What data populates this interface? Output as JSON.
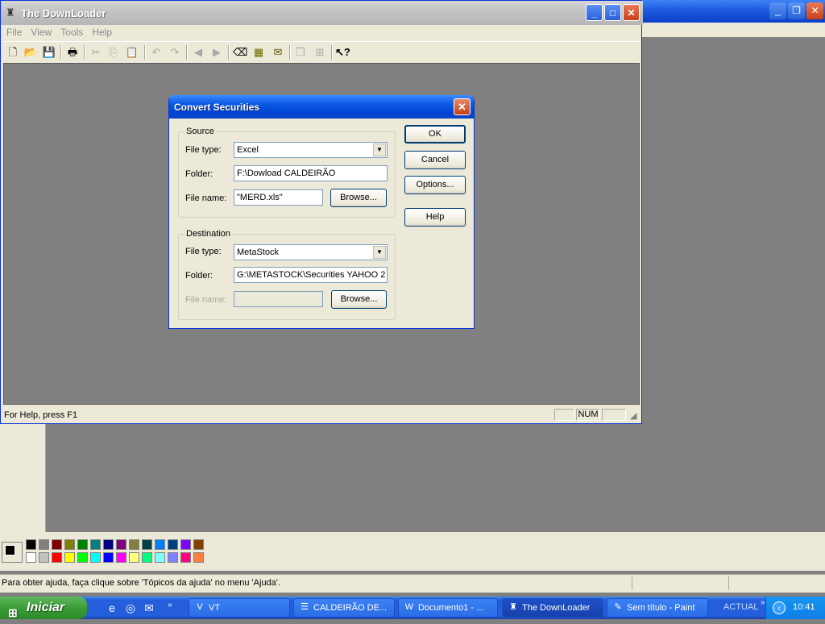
{
  "paint": {
    "status": "Para obter ajuda, faça clique sobre 'Tópicos da ajuda' no menu 'Ajuda'.",
    "palette_top": [
      "#000000",
      "#808080",
      "#800000",
      "#808000",
      "#008000",
      "#008080",
      "#000080",
      "#800080",
      "#808040",
      "#004040",
      "#0080ff",
      "#004080",
      "#8000ff",
      "#804000"
    ],
    "palette_bottom": [
      "#ffffff",
      "#c0c0c0",
      "#ff0000",
      "#ffff00",
      "#00ff00",
      "#00ffff",
      "#0000ff",
      "#ff00ff",
      "#ffff80",
      "#00ff80",
      "#80ffff",
      "#8080ff",
      "#ff0080",
      "#ff8040"
    ]
  },
  "downloader": {
    "title": "The DownLoader",
    "menu": {
      "file": "File",
      "view": "View",
      "tools": "Tools",
      "help": "Help"
    },
    "status_text": "For Help, press F1",
    "status_num": "NUM"
  },
  "dialog": {
    "title": "Convert Securities",
    "source": {
      "legend": "Source",
      "file_type_label": "File type:",
      "file_type_value": "Excel",
      "folder_label": "Folder:",
      "folder_value": "F:\\Dowload CALDEIRÃO",
      "file_name_label": "File name:",
      "file_name_value": "\"MERD.xls\"",
      "browse_label": "Browse..."
    },
    "destination": {
      "legend": "Destination",
      "file_type_label": "File type:",
      "file_type_value": "MetaStock",
      "folder_label": "Folder:",
      "folder_value": "G:\\METASTOCK\\Securities YAHOO 2",
      "file_name_label": "File name:",
      "file_name_value": "",
      "browse_label": "Browse..."
    },
    "buttons": {
      "ok": "OK",
      "cancel": "Cancel",
      "options": "Options...",
      "help": "Help"
    }
  },
  "taskbar": {
    "start": "Iniciar",
    "tasks": [
      "VT",
      "CALDEIRÃO DE...",
      "Documento1 - ...",
      "The DownLoader",
      "Sem título - Paint"
    ],
    "tray_label": "ACTUAL",
    "clock": "10:41"
  }
}
